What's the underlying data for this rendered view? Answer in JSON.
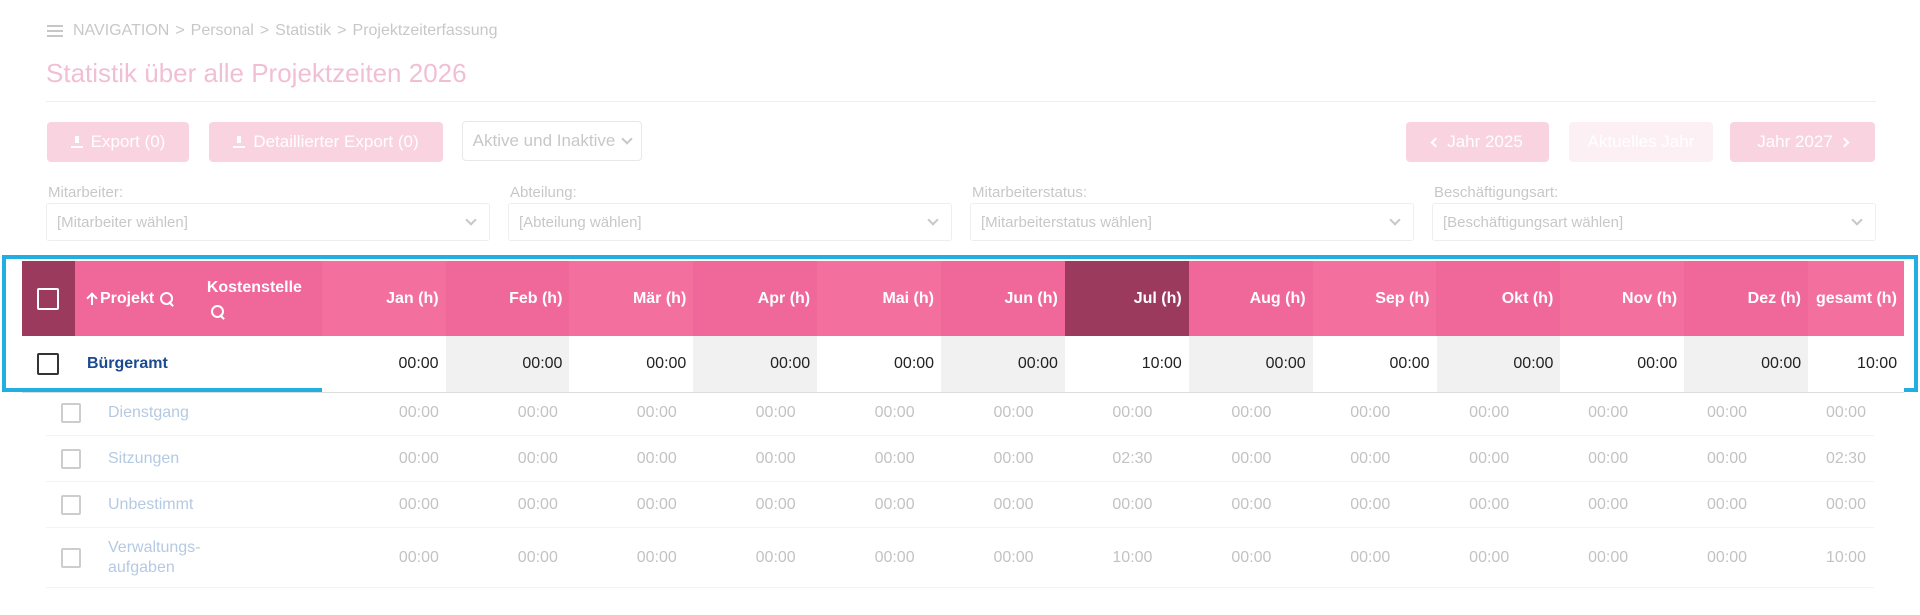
{
  "breadcrumb": {
    "items": [
      "NAVIGATION",
      "Personal",
      "Statistik",
      "Projektzeiterfassung"
    ],
    "separator": ">"
  },
  "page_title": "Statistik über alle Projektzeiten 2026",
  "toolbar": {
    "export_label": "Export (0)",
    "detailed_export_label": "Detaillierter Export (0)",
    "status_filter_value": "Aktive und Inaktive",
    "prev_year_label": "Jahr 2025",
    "current_year_label": "Aktuelles Jahr",
    "next_year_label": "Jahr 2027"
  },
  "filters": [
    {
      "label": "Mitarbeiter:",
      "placeholder": "[Mitarbeiter wählen]"
    },
    {
      "label": "Abteilung:",
      "placeholder": "[Abteilung wählen]"
    },
    {
      "label": "Mitarbeiterstatus:",
      "placeholder": "[Mitarbeiterstatus wählen]"
    },
    {
      "label": "Beschäftigungsart:",
      "placeholder": "[Beschäftigungsart wählen]"
    }
  ],
  "table": {
    "col_project": "Projekt",
    "col_cost_center": "Kostenstelle",
    "months": [
      "Jan (h)",
      "Feb (h)",
      "Mär (h)",
      "Apr (h)",
      "Mai (h)",
      "Jun (h)",
      "Jul (h)",
      "Aug (h)",
      "Sep (h)",
      "Okt (h)",
      "Nov (h)",
      "Dez (h)"
    ],
    "col_total": "gesamt (h)",
    "rows": [
      {
        "name": "Bürgeramt",
        "values": [
          "00:00",
          "00:00",
          "00:00",
          "00:00",
          "00:00",
          "00:00",
          "10:00",
          "00:00",
          "00:00",
          "00:00",
          "00:00",
          "00:00"
        ],
        "total": "10:00"
      },
      {
        "name": "Dienstgang",
        "values": [
          "00:00",
          "00:00",
          "00:00",
          "00:00",
          "00:00",
          "00:00",
          "00:00",
          "00:00",
          "00:00",
          "00:00",
          "00:00",
          "00:00"
        ],
        "total": "00:00"
      },
      {
        "name": "Sitzungen",
        "values": [
          "00:00",
          "00:00",
          "00:00",
          "00:00",
          "00:00",
          "00:00",
          "02:30",
          "00:00",
          "00:00",
          "00:00",
          "00:00",
          "00:00"
        ],
        "total": "02:30"
      },
      {
        "name": "Unbestimmt",
        "values": [
          "00:00",
          "00:00",
          "00:00",
          "00:00",
          "00:00",
          "00:00",
          "00:00",
          "00:00",
          "00:00",
          "00:00",
          "00:00",
          "00:00"
        ],
        "total": "00:00"
      },
      {
        "name": "Verwaltungs-\naufgaben",
        "values": [
          "00:00",
          "00:00",
          "00:00",
          "00:00",
          "00:00",
          "00:00",
          "10:00",
          "00:00",
          "00:00",
          "00:00",
          "00:00",
          "00:00"
        ],
        "total": "10:00"
      }
    ]
  },
  "colors": {
    "header_pink": "#f0679a",
    "header_pink_light": "#f36f9e",
    "header_dark": "#9c3a5e",
    "highlight_border": "#22aee0",
    "link_blue": "#1a4a90"
  }
}
